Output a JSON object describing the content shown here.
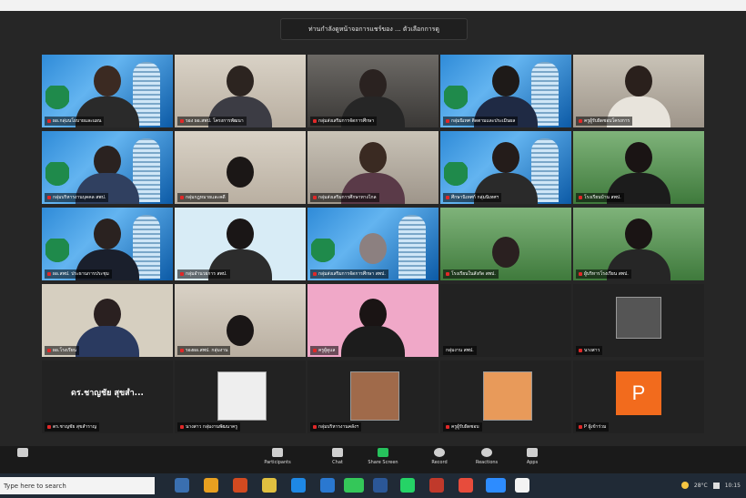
{
  "share_banner": "ท่านกำลังดูหน้าจอการแชร์ของ ... ตัวเลือกการดู",
  "participants": [
    {
      "name": "ผอ.กลุ่มนโยบายและแผน"
    },
    {
      "name": "รอง ผอ.สพป. โครงการพัฒนา"
    },
    {
      "name": "กลุ่มส่งเสริมการจัดการศึกษา"
    },
    {
      "name": "กลุ่มนิเทศ ติดตามและประเมินผล"
    },
    {
      "name": "ครูผู้รับผิดชอบโครงการ"
    },
    {
      "name": "กลุ่มบริหารงานบุคคล สพป."
    },
    {
      "name": "กลุ่มกฎหมายและคดี"
    },
    {
      "name": "กลุ่มส่งเสริมการศึกษาทางไกล"
    },
    {
      "name": "ศึกษานิเทศก์ กลุ่มนิเทศฯ"
    },
    {
      "name": "โรงเรียนบ้าน สพป."
    },
    {
      "name": "ผอ.สพป. ประธานการประชุม"
    },
    {
      "name": "กลุ่มอำนวยการ สพป."
    },
    {
      "name": "กลุ่มส่งเสริมการจัดการศึกษา สพป."
    },
    {
      "name": "โรงเรียนในสังกัด สพป."
    },
    {
      "name": "ผู้บริหารโรงเรียน สพป."
    },
    {
      "name": "ผอ.โรงเรียน"
    },
    {
      "name": "รองผอ.สพป. กลุ่มงาน"
    },
    {
      "name": "ครูผู้ดูแล"
    },
    {
      "name": "กลุ่มงาน สพป."
    },
    {
      "name": "นางสาว"
    },
    {
      "name": "ดร.ชาญชัย สุขสำราญ"
    },
    {
      "name": "นางสาว กลุ่มงานพัฒนาครู"
    },
    {
      "name": "กลุ่มบริหารงานคลังฯ"
    },
    {
      "name": "ครูผู้รับผิดชอบ"
    },
    {
      "name": "P ผู้เข้าร่วม"
    }
  ],
  "avatar_text": "ดร.ชาญชัย สุขสำ...",
  "avatar_letter": "P",
  "toolbar": {
    "participants": "Participants",
    "chat": "Chat",
    "share_screen": "Share Screen",
    "record": "Record",
    "reactions": "Reactions",
    "apps": "Apps"
  },
  "taskbar": {
    "search_placeholder": "Type here to search",
    "temp": "28°C",
    "time": "10:15"
  }
}
